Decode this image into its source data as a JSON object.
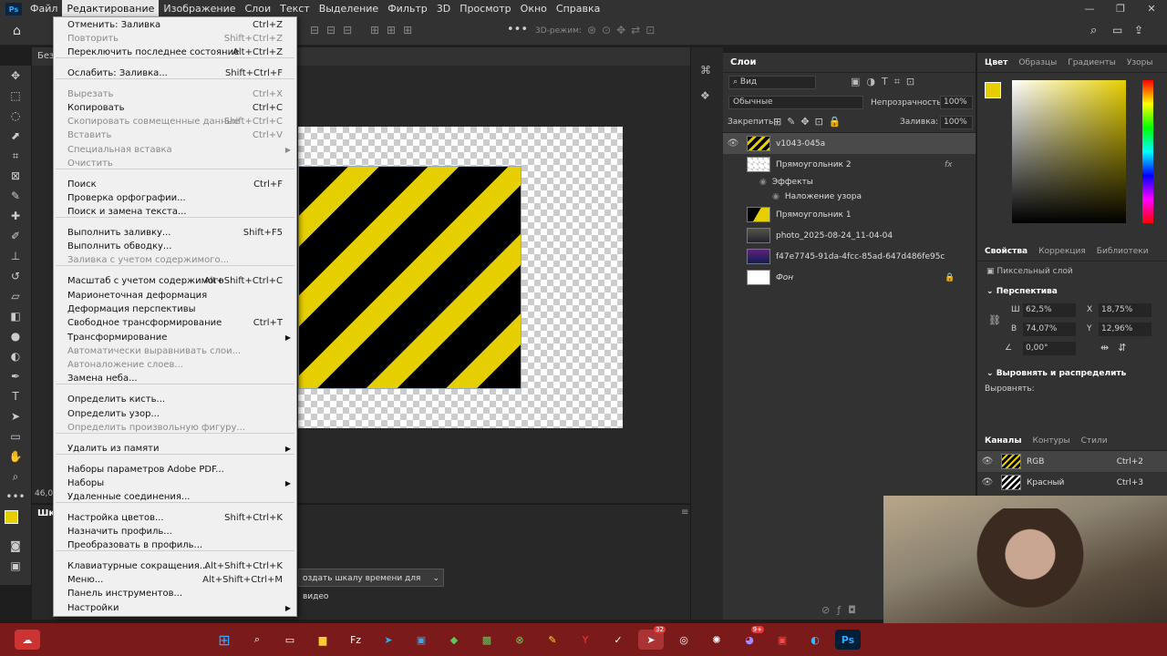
{
  "menubar": {
    "items": [
      "Файл",
      "Редактирование",
      "Изображение",
      "Слои",
      "Текст",
      "Выделение",
      "Фильтр",
      "3D",
      "Просмотр",
      "Окно",
      "Справка"
    ],
    "active_index": 1
  },
  "window_controls": {
    "minimize": "—",
    "restore": "❐",
    "close": "✕"
  },
  "options_bar": {
    "mode3d": "3D-режим:"
  },
  "document": {
    "tab": "Без",
    "zoom": "46,0"
  },
  "timeline": {
    "title": "Шка",
    "create_button": "оздать шкалу времени для видео"
  },
  "edit_menu": {
    "items": [
      {
        "label": "Отменить: Заливка",
        "shortcut": "Ctrl+Z",
        "enabled": true
      },
      {
        "label": "Повторить",
        "shortcut": "Shift+Ctrl+Z",
        "enabled": false
      },
      {
        "label": "Переключить последнее состояние",
        "shortcut": "Alt+Ctrl+Z",
        "enabled": true
      },
      {
        "sep": true
      },
      {
        "label": "Ослабить: Заливка...",
        "shortcut": "Shift+Ctrl+F",
        "enabled": true
      },
      {
        "sep": true
      },
      {
        "label": "Вырезать",
        "shortcut": "Ctrl+X",
        "enabled": false
      },
      {
        "label": "Копировать",
        "shortcut": "Ctrl+C",
        "enabled": true
      },
      {
        "label": "Скопировать совмещенные данные",
        "shortcut": "Shift+Ctrl+C",
        "enabled": false
      },
      {
        "label": "Вставить",
        "shortcut": "Ctrl+V",
        "enabled": false
      },
      {
        "label": "Специальная вставка",
        "shortcut": "",
        "enabled": false,
        "submenu": true
      },
      {
        "label": "Очистить",
        "shortcut": "",
        "enabled": false
      },
      {
        "sep": true
      },
      {
        "label": "Поиск",
        "shortcut": "Ctrl+F",
        "enabled": true
      },
      {
        "label": "Проверка орфографии...",
        "shortcut": "",
        "enabled": true
      },
      {
        "label": "Поиск и замена текста...",
        "shortcut": "",
        "enabled": true
      },
      {
        "sep": true
      },
      {
        "label": "Выполнить заливку...",
        "shortcut": "Shift+F5",
        "enabled": true
      },
      {
        "label": "Выполнить обводку...",
        "shortcut": "",
        "enabled": true
      },
      {
        "label": "Заливка с учетом содержимого...",
        "shortcut": "",
        "enabled": false
      },
      {
        "sep": true
      },
      {
        "label": "Масштаб с учетом содержимого",
        "shortcut": "Alt+Shift+Ctrl+C",
        "enabled": true
      },
      {
        "label": "Марионеточная деформация",
        "shortcut": "",
        "enabled": true
      },
      {
        "label": "Деформация перспективы",
        "shortcut": "",
        "enabled": true
      },
      {
        "label": "Свободное трансформирование",
        "shortcut": "Ctrl+T",
        "enabled": true
      },
      {
        "label": "Трансформирование",
        "shortcut": "",
        "enabled": true,
        "submenu": true
      },
      {
        "label": "Автоматически выравнивать слои...",
        "shortcut": "",
        "enabled": false
      },
      {
        "label": "Автоналожение слоев...",
        "shortcut": "",
        "enabled": false
      },
      {
        "label": "Замена неба...",
        "shortcut": "",
        "enabled": true
      },
      {
        "sep": true
      },
      {
        "label": "Определить кисть...",
        "shortcut": "",
        "enabled": true
      },
      {
        "label": "Определить узор...",
        "shortcut": "",
        "enabled": true
      },
      {
        "label": "Определить произвольную фигуру...",
        "shortcut": "",
        "enabled": false
      },
      {
        "sep": true
      },
      {
        "label": "Удалить из памяти",
        "shortcut": "",
        "enabled": true,
        "submenu": true
      },
      {
        "sep": true
      },
      {
        "label": "Наборы параметров Adobe PDF...",
        "shortcut": "",
        "enabled": true
      },
      {
        "label": "Наборы",
        "shortcut": "",
        "enabled": true,
        "submenu": true
      },
      {
        "label": "Удаленные соединения...",
        "shortcut": "",
        "enabled": true
      },
      {
        "sep": true
      },
      {
        "label": "Настройка цветов...",
        "shortcut": "Shift+Ctrl+K",
        "enabled": true
      },
      {
        "label": "Назначить профиль...",
        "shortcut": "",
        "enabled": true
      },
      {
        "label": "Преобразовать в профиль...",
        "shortcut": "",
        "enabled": true
      },
      {
        "sep": true
      },
      {
        "label": "Клавиатурные сокращения...",
        "shortcut": "Alt+Shift+Ctrl+K",
        "enabled": true
      },
      {
        "label": "Меню...",
        "shortcut": "Alt+Shift+Ctrl+M",
        "enabled": true
      },
      {
        "label": "Панель инструментов...",
        "shortcut": "",
        "enabled": true
      },
      {
        "label": "Настройки",
        "shortcut": "",
        "enabled": true,
        "submenu": true
      }
    ]
  },
  "layers_panel": {
    "title": "Слои",
    "kind_filter": "Вид",
    "blend_mode": "Обычные",
    "opacity_label": "Непрозрачность:",
    "opacity_value": "100%",
    "lock_label": "Закрепить:",
    "fill_label": "Заливка:",
    "fill_value": "100%",
    "effects_label": "Эффекты",
    "pattern_overlay_label": "Наложение узора",
    "layers": [
      {
        "name": "v1043-045a",
        "visible": true,
        "selected": true
      },
      {
        "name": "Прямоугольник 2",
        "visible": false,
        "selected": false,
        "fx": "fx"
      },
      {
        "name": "Прямоугольник 1",
        "visible": false,
        "selected": false
      },
      {
        "name": "photo_2025-08-24_11-04-04",
        "visible": false,
        "selected": false
      },
      {
        "name": "f47e7745-91da-4fcc-85ad-647d486fe95c",
        "visible": false,
        "selected": false
      },
      {
        "name": "Фон",
        "visible": false,
        "selected": false,
        "locked": true
      }
    ]
  },
  "color_panel": {
    "tabs": [
      "Цвет",
      "Образцы",
      "Градиенты",
      "Узоры"
    ],
    "fg_color": "#e6cf00"
  },
  "properties_panel": {
    "tabs": [
      "Свойства",
      "Коррекция",
      "Библиотеки"
    ],
    "layer_kind": "Пиксельный слой",
    "section_perspective": "Перспектива",
    "w_label": "Ш",
    "w_value": "62,5%",
    "h_label": "В",
    "h_value": "74,07%",
    "x_label": "X",
    "x_value": "18,75%",
    "y_label": "Y",
    "y_value": "12,96%",
    "angle_value": "0,00°",
    "section_align": "Выровнять и распределить",
    "align_label": "Выровнять:"
  },
  "channels_panel": {
    "tabs": [
      "Каналы",
      "Контуры",
      "Стили"
    ],
    "channels": [
      {
        "name": "RGB",
        "shortcut": "Ctrl+2"
      },
      {
        "name": "Красный",
        "shortcut": "Ctrl+3"
      }
    ]
  },
  "taskbar": {
    "telegram_badge": "32",
    "discord_badge": "9+"
  }
}
